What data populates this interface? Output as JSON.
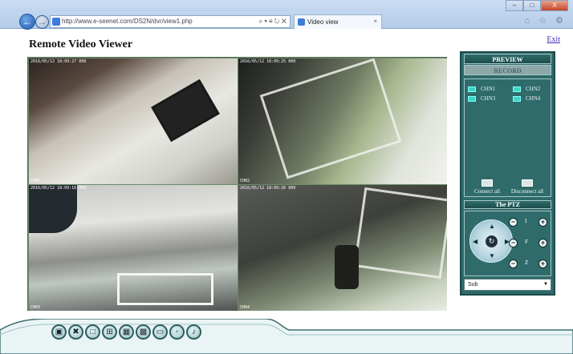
{
  "browser": {
    "url": "http://www.e-seenet.com/DS2N/dvr/view1.php",
    "address_tools": "⌕ ▾ ≡ ↻ ✕",
    "tab_title": "Video view",
    "tab_close": "×",
    "back_icon": "←",
    "forward_icon": "→",
    "window_buttons": {
      "minimize": "–",
      "maximize": "□",
      "close": "X"
    },
    "chrome_icons": "⌂ ☆ ⚙"
  },
  "page": {
    "title": "Remote Video Viewer",
    "exit_label": "Exit"
  },
  "cameras": [
    {
      "timestamp": "2016/05/12 18:09:27 000",
      "label": "CH01"
    },
    {
      "timestamp": "2016/05/12 18:09:25 000",
      "label": "CH02"
    },
    {
      "timestamp": "2016/05/12 18:09:16 000",
      "label": "CH03"
    },
    {
      "timestamp": "2016/05/12 18:09:26 000",
      "label": "CH04"
    }
  ],
  "panel": {
    "preview_label": "PREVIEW",
    "record_label": "RECORD",
    "channels": [
      "CHN1",
      "CHN2",
      "CHN3",
      "CHN4"
    ],
    "connect_all": "Connect all",
    "disconnect_all": "Disconnect all",
    "ptz_title": "The PTZ",
    "ptz_center_icon": "↻",
    "ptz_up": "▲",
    "ptz_down": "▼",
    "ptz_left": "◀",
    "ptz_right": "▶",
    "zoom_rows": [
      {
        "label": "I"
      },
      {
        "label": "F"
      },
      {
        "label": "Z"
      }
    ],
    "minus_glyph": "−",
    "plus_glyph": "+",
    "stream_value": "Sub",
    "stream_arrow": "▼"
  },
  "toolbar": {
    "buttons": [
      {
        "icon": "camera-icon",
        "glyph": "▣"
      },
      {
        "icon": "tools-icon",
        "glyph": "✖"
      },
      {
        "icon": "layout-1-icon",
        "glyph": "□"
      },
      {
        "icon": "layout-4-icon",
        "glyph": "⊞"
      },
      {
        "icon": "layout-9-icon",
        "glyph": "▦"
      },
      {
        "icon": "layout-16-icon",
        "glyph": "▩"
      },
      {
        "icon": "fullscreen-icon",
        "glyph": "▭"
      },
      {
        "icon": "screenshot-icon",
        "glyph": "▫"
      },
      {
        "icon": "audio-icon",
        "glyph": "♪"
      }
    ]
  },
  "colors": {
    "panel": "#2f6a6a",
    "panel_border": "#1c4a4b",
    "link": "#4a2ab8"
  }
}
